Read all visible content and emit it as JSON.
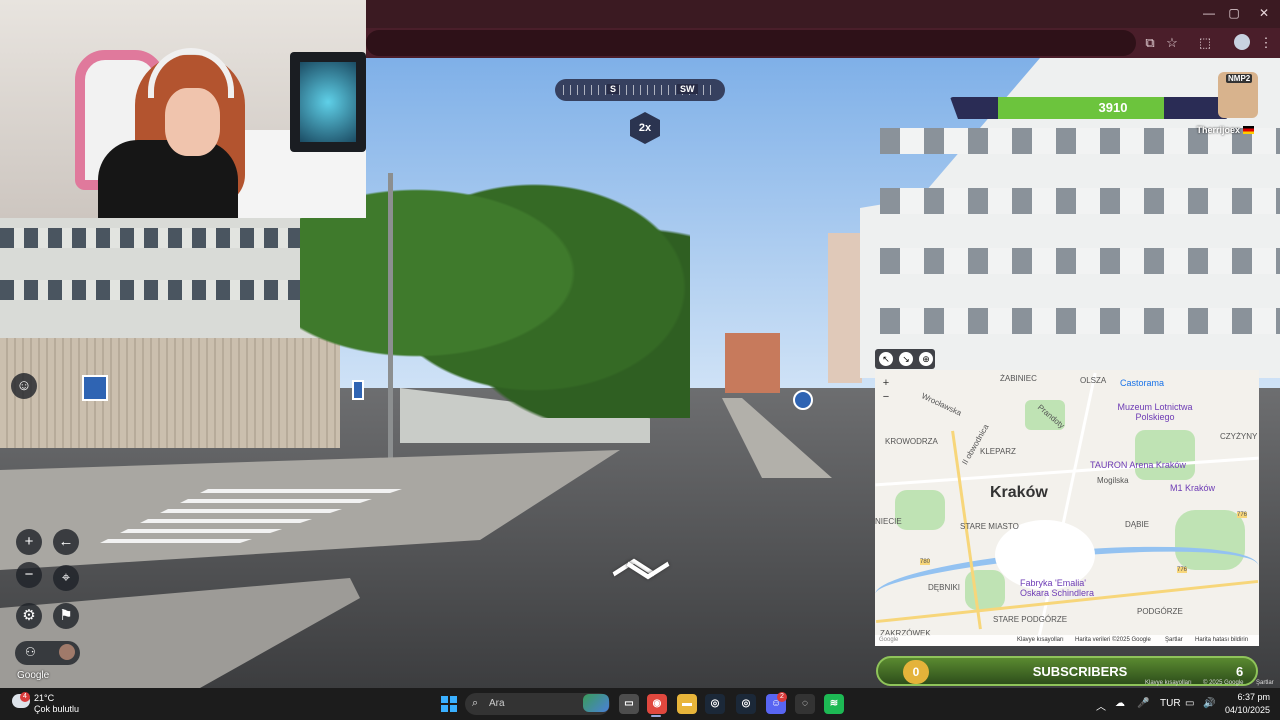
{
  "browser": {
    "window_controls": {
      "minimize": "—",
      "maximize": "▢",
      "close": "✕"
    },
    "toolbar_icons": [
      "cast-icon",
      "star-icon",
      "extensions-icon",
      "menu-icon"
    ]
  },
  "game": {
    "compass": {
      "left_label": "S",
      "right_label": "SW"
    },
    "multiplier": "2x",
    "health": {
      "value": "3910",
      "fraction": 0.72,
      "color": "#6cc43d"
    },
    "player": {
      "name": "Therrijoex",
      "avatar_badge": "NMP2",
      "flag": "DE"
    },
    "controls": {
      "zoom_in": "+",
      "zoom_out": "−",
      "back": "←",
      "pin": "⌖",
      "settings": "⚙",
      "flag": "⚑",
      "emoji": "☺",
      "party": "⚇"
    },
    "google_label": "Google",
    "nav_arrow_forward": "︿",
    "nav_arrow_back": "﹀"
  },
  "minimap": {
    "tools": [
      "↖",
      "↘",
      "⊕"
    ],
    "zoom_in": "+",
    "zoom_out": "−",
    "city_label": "Kraków",
    "labels": {
      "zabiniec": "ŻABINIEC",
      "olsza": "OLSZA",
      "castorama": "Castorama",
      "wroclawska": "Wrocławska",
      "museum": "Muzeum Lotnictwa Polskiego",
      "prandoty": "Prandoty",
      "krowodrza": "KROWODRZA",
      "obwodnica": "II obwodnica",
      "kleparz": "KLEPARZ",
      "czyzyny": "CZYŻYNY",
      "tauron": "TAURON Arena Kraków",
      "mogilska": "Mogilska",
      "m1": "M1 Kraków",
      "stare_miasto": "STARE MIASTO",
      "dabie": "DĄBIE",
      "niecie": "NIECIE",
      "debniki": "DĘBNIKI",
      "fabryka": "Fabryka 'Emalia' Oskara Schindlera",
      "podgorze": "PODGÓRZE",
      "stare_podgorze": "STARE PODGÓRZE",
      "zakrzowek": "ZAKRZÓWEK",
      "r780": "780",
      "r776": "776",
      "r776b": "776"
    },
    "footer": {
      "google": "Google",
      "shortcuts": "Klavye kısayolları",
      "data": "Harita verileri ©2025 Google",
      "terms": "Şartlar",
      "report": "Harita hatası bildirin"
    }
  },
  "subscribers": {
    "current": "0",
    "label": "SUBSCRIBERS",
    "goal": "6"
  },
  "overlay_footer": {
    "shortcuts": "Klavye kısayolları",
    "data": "© 2025 Google",
    "terms": "Şartlar"
  },
  "taskbar": {
    "weather": {
      "temp": "21°C",
      "desc": "Çok bulutlu",
      "badge": "4"
    },
    "search_placeholder": "Ara",
    "apps": [
      {
        "name": "file-explorer-icon",
        "glyph": "▭",
        "color": "#4d4d4d"
      },
      {
        "name": "chrome-icon",
        "glyph": "◉",
        "color": "#e0483e"
      },
      {
        "name": "folder-icon",
        "glyph": "▬",
        "color": "#e8b53a"
      },
      {
        "name": "steam-icon",
        "glyph": "◎",
        "color": "#1b2838"
      },
      {
        "name": "steam-icon-2",
        "glyph": "◎",
        "color": "#1b2838"
      },
      {
        "name": "discord-icon",
        "glyph": "☺",
        "color": "#5865f2"
      },
      {
        "name": "obs-icon",
        "glyph": "◌",
        "color": "#333"
      },
      {
        "name": "spotify-icon",
        "glyph": "≋",
        "color": "#1db954"
      }
    ],
    "discord_badge": "2",
    "tray": {
      "chevron": "︿",
      "cloud": "☁",
      "mic": "🎤",
      "lang": "TUR",
      "network": "▭",
      "sound": "🔊"
    },
    "clock": {
      "time": "6:37 pm",
      "date": "04/10/2025"
    }
  }
}
